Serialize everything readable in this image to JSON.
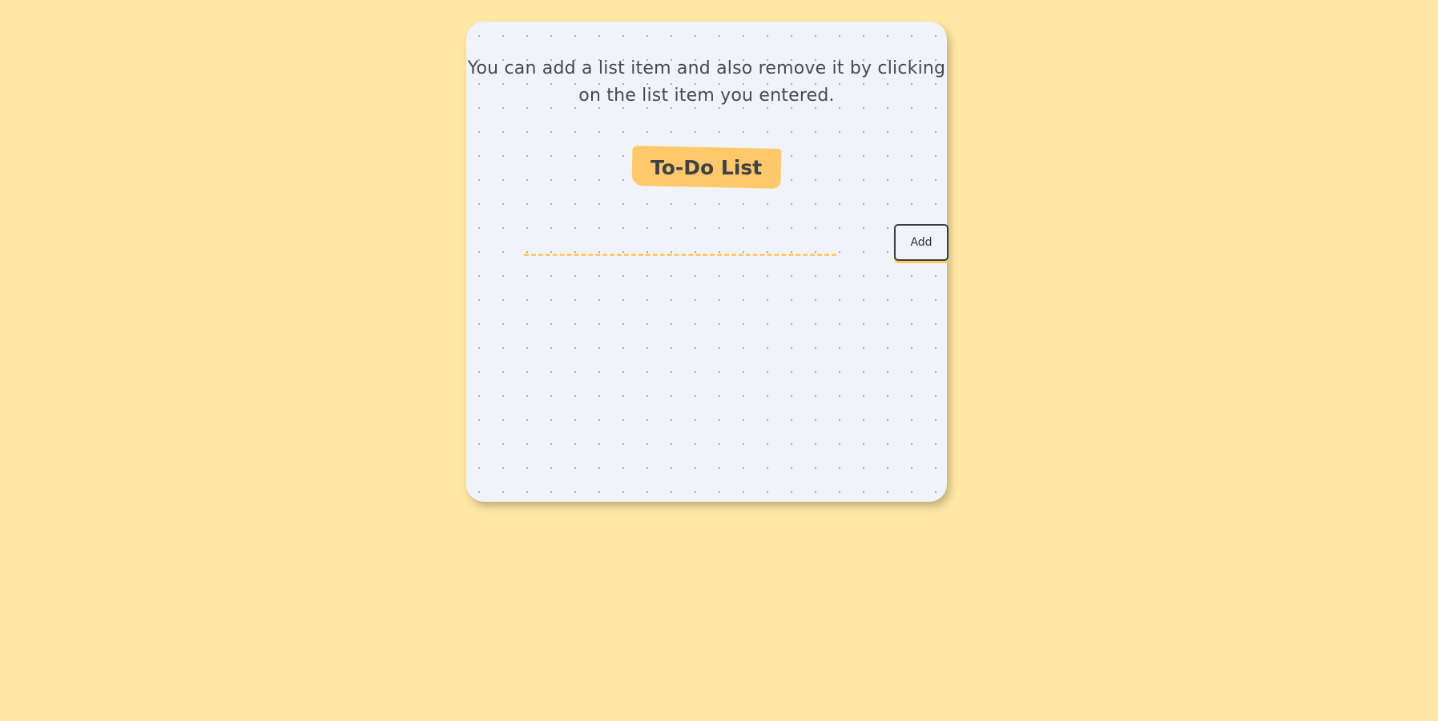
{
  "intro": {
    "text": "You can add a list item and also remove it by clicking on the list item you entered."
  },
  "title": "To-Do List",
  "form": {
    "input_value": "",
    "input_placeholder": "",
    "add_label": "Add"
  },
  "todos": [],
  "colors": {
    "background": "#ffe8a5",
    "card": "#f0f4f8",
    "accent": "#ffc96b",
    "text": "#454a52"
  }
}
